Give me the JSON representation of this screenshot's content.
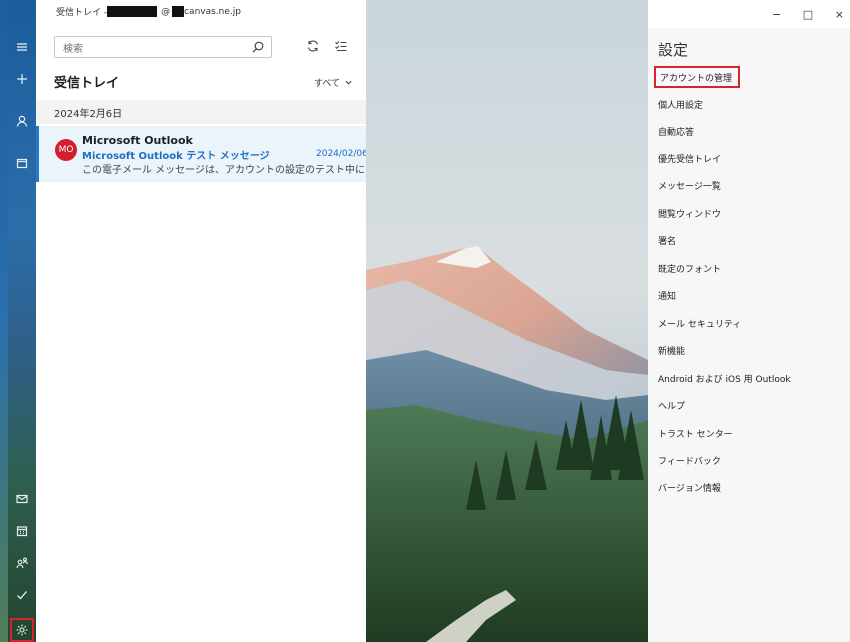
{
  "window": {
    "title_prefix": "受信トレイ - ",
    "title_at": "@",
    "title_domain": "canvas.ne.jp",
    "minimize": "−",
    "maximize": "□",
    "close": "×"
  },
  "nav_rail": {
    "top_icons": [
      "hamburger-icon",
      "plus-icon",
      "person-icon",
      "folder-icon"
    ],
    "bottom_icons": [
      "mail-icon",
      "calendar-icon",
      "people-icon",
      "todo-icon",
      "gear-icon"
    ]
  },
  "list": {
    "search_placeholder": "検索",
    "folder_title": "受信トレイ",
    "filter_label": "すべて",
    "date_header": "2024年2月6日",
    "messages": [
      {
        "avatar_initials": "MO",
        "avatar_color": "#d21f2b",
        "sender": "Microsoft Outlook",
        "subject": "Microsoft Outlook テスト メッセージ",
        "date": "2024/02/06",
        "preview": "この電子メール メッセージは、アカウントの設定のテスト中に"
      }
    ]
  },
  "settings": {
    "heading": "設定",
    "items": [
      "アカウントの管理",
      "個人用設定",
      "自動応答",
      "優先受信トレイ",
      "メッセージ一覧",
      "閲覧ウィンドウ",
      "署名",
      "既定のフォント",
      "通知",
      "メール セキュリティ",
      "新機能",
      "Android および iOS 用 Outlook",
      "ヘルプ",
      "トラスト センター",
      "フィードバック",
      "バージョン情報"
    ]
  },
  "colors": {
    "accent": "#2b78c5",
    "highlight_box": "#d8232a",
    "selected_row": "#ebf3fb"
  }
}
